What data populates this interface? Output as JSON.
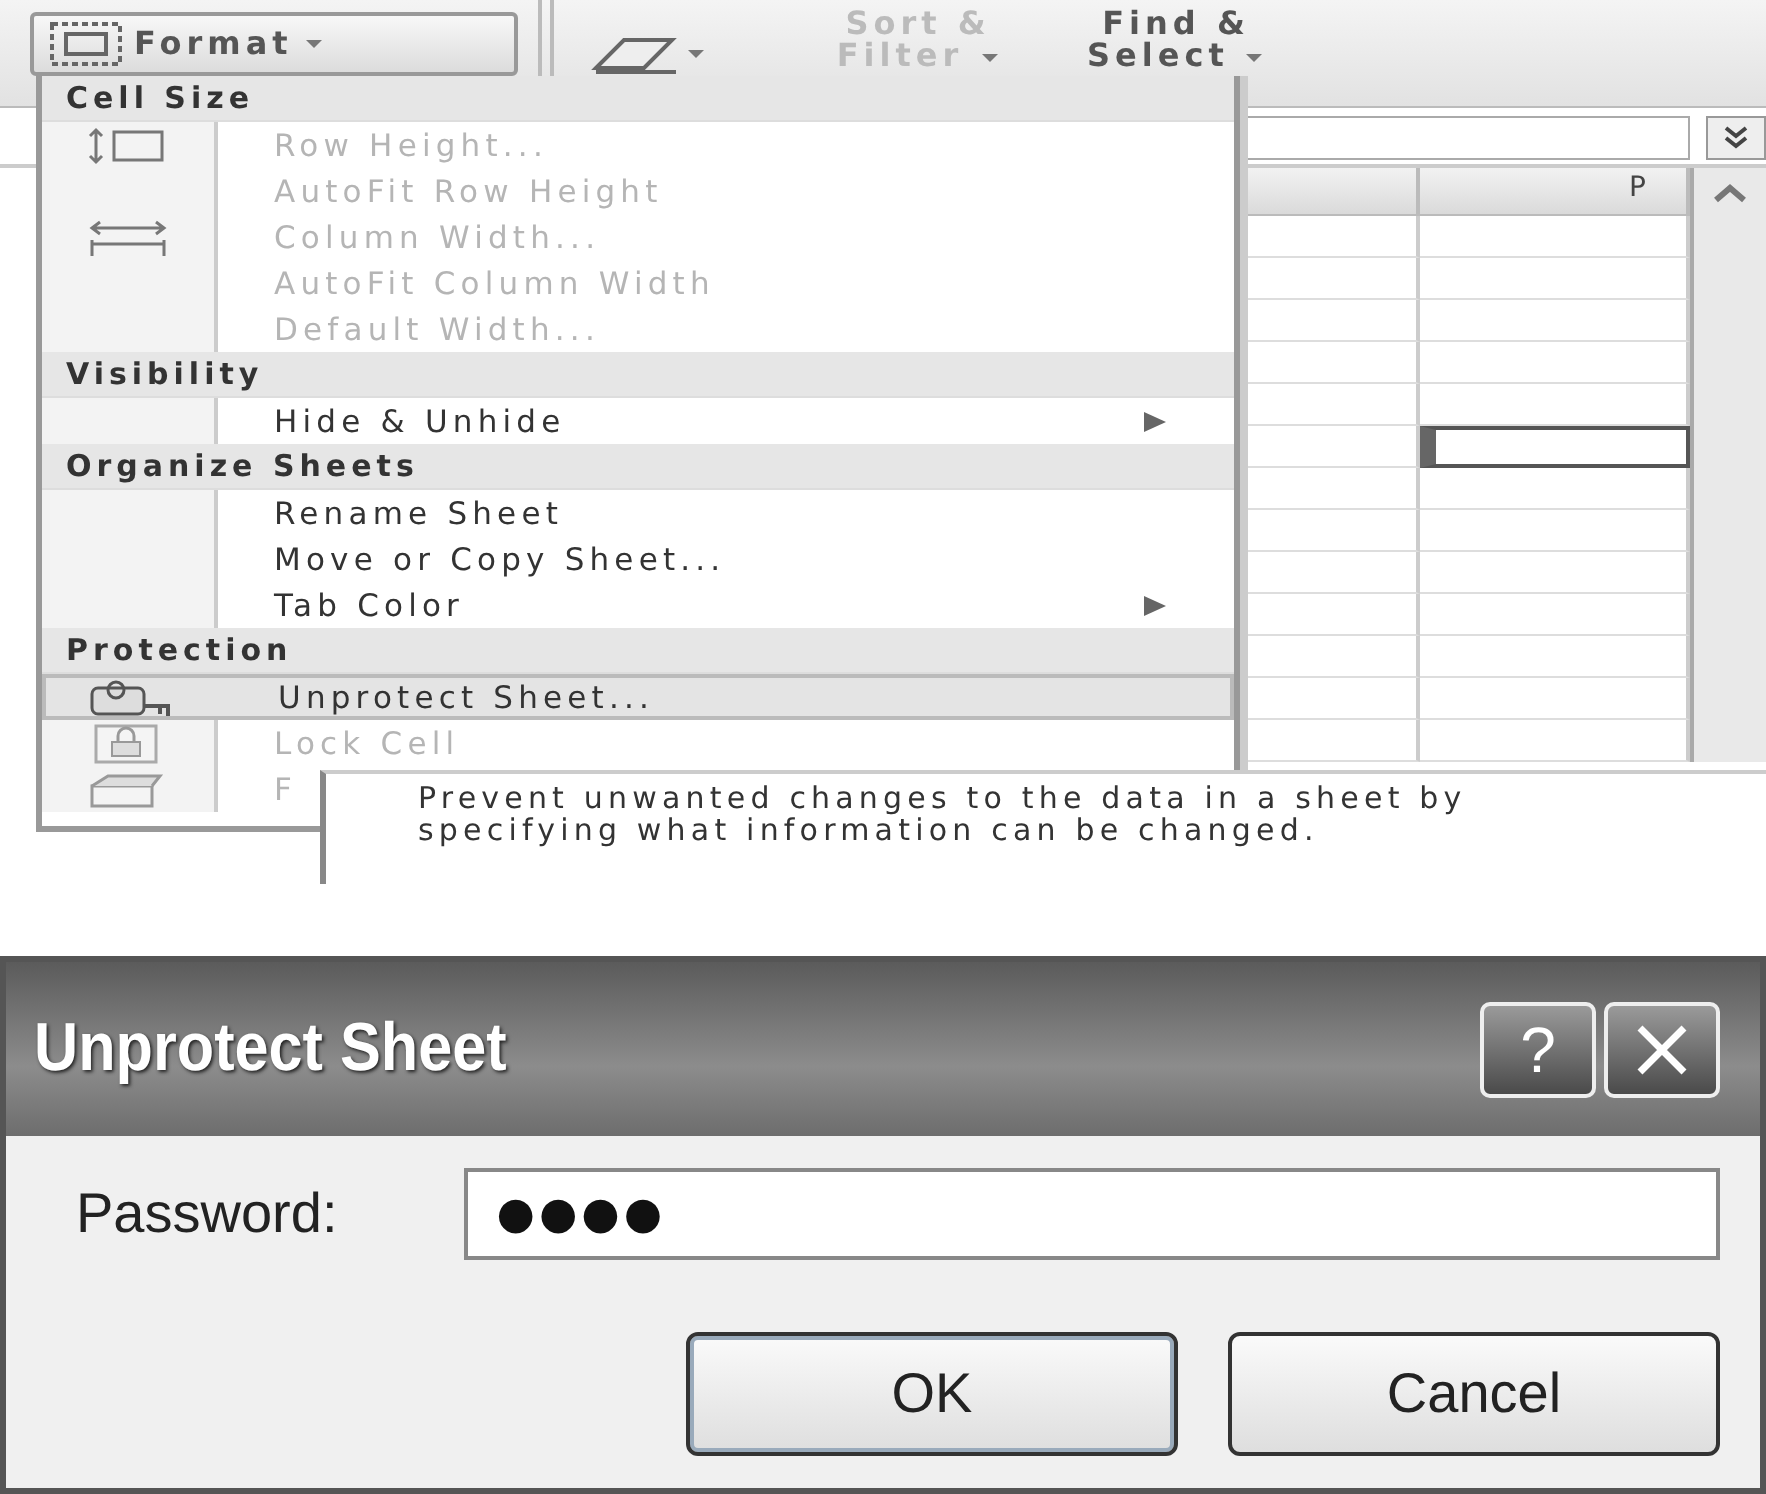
{
  "ribbon": {
    "format_button": {
      "label": "Format"
    },
    "sort_filter": {
      "label": "Sort & Filter",
      "disabled": true
    },
    "find_select": {
      "label": "Find & Select",
      "disabled": false
    }
  },
  "menu": [
    {
      "kind": "header",
      "label": "Cell Size"
    },
    {
      "kind": "item",
      "label": "Row Height...",
      "disabled": true,
      "selected": false,
      "submenu": false
    },
    {
      "kind": "item",
      "label": "AutoFit Row Height",
      "disabled": true,
      "selected": false,
      "submenu": false
    },
    {
      "kind": "item",
      "label": "Column Width...",
      "disabled": true,
      "selected": false,
      "submenu": false
    },
    {
      "kind": "item",
      "label": "AutoFit Column Width",
      "disabled": true,
      "selected": false,
      "submenu": false
    },
    {
      "kind": "item",
      "label": "Default Width...",
      "disabled": true,
      "selected": false,
      "submenu": false
    },
    {
      "kind": "header",
      "label": "Visibility"
    },
    {
      "kind": "item",
      "label": "Hide & Unhide",
      "disabled": false,
      "selected": false,
      "submenu": true
    },
    {
      "kind": "header",
      "label": "Organize Sheets"
    },
    {
      "kind": "item",
      "label": "Rename Sheet",
      "disabled": false,
      "selected": false,
      "submenu": false
    },
    {
      "kind": "item",
      "label": "Move or Copy Sheet...",
      "disabled": false,
      "selected": false,
      "submenu": false
    },
    {
      "kind": "item",
      "label": "Tab Color",
      "disabled": false,
      "selected": false,
      "submenu": true
    },
    {
      "kind": "header",
      "label": "Protection"
    },
    {
      "kind": "item",
      "label": "Unprotect Sheet...",
      "disabled": false,
      "selected": true,
      "submenu": false
    },
    {
      "kind": "item",
      "label": "Lock Cell",
      "disabled": true,
      "selected": false,
      "submenu": false
    },
    {
      "kind": "item",
      "label": "F",
      "disabled": true,
      "selected": false,
      "submenu": false
    }
  ],
  "sheet": {
    "column_header": "P",
    "rows": [
      {
        "selected": false
      },
      {
        "selected": false
      },
      {
        "selected": false
      },
      {
        "selected": false
      },
      {
        "selected": false
      },
      {
        "selected": true
      },
      {
        "selected": false
      },
      {
        "selected": false
      },
      {
        "selected": false
      },
      {
        "selected": false
      },
      {
        "selected": false
      },
      {
        "selected": false
      },
      {
        "selected": false
      }
    ]
  },
  "tooltip": {
    "text": "Prevent unwanted changes to the data in a sheet by specifying what information can be changed."
  },
  "dialog": {
    "title": "Unprotect Sheet",
    "help_button": "?",
    "password_label": "Password:",
    "password_value": "●●●●",
    "buttons": [
      {
        "label": "OK",
        "default": true
      },
      {
        "label": "Cancel",
        "default": false
      }
    ]
  }
}
